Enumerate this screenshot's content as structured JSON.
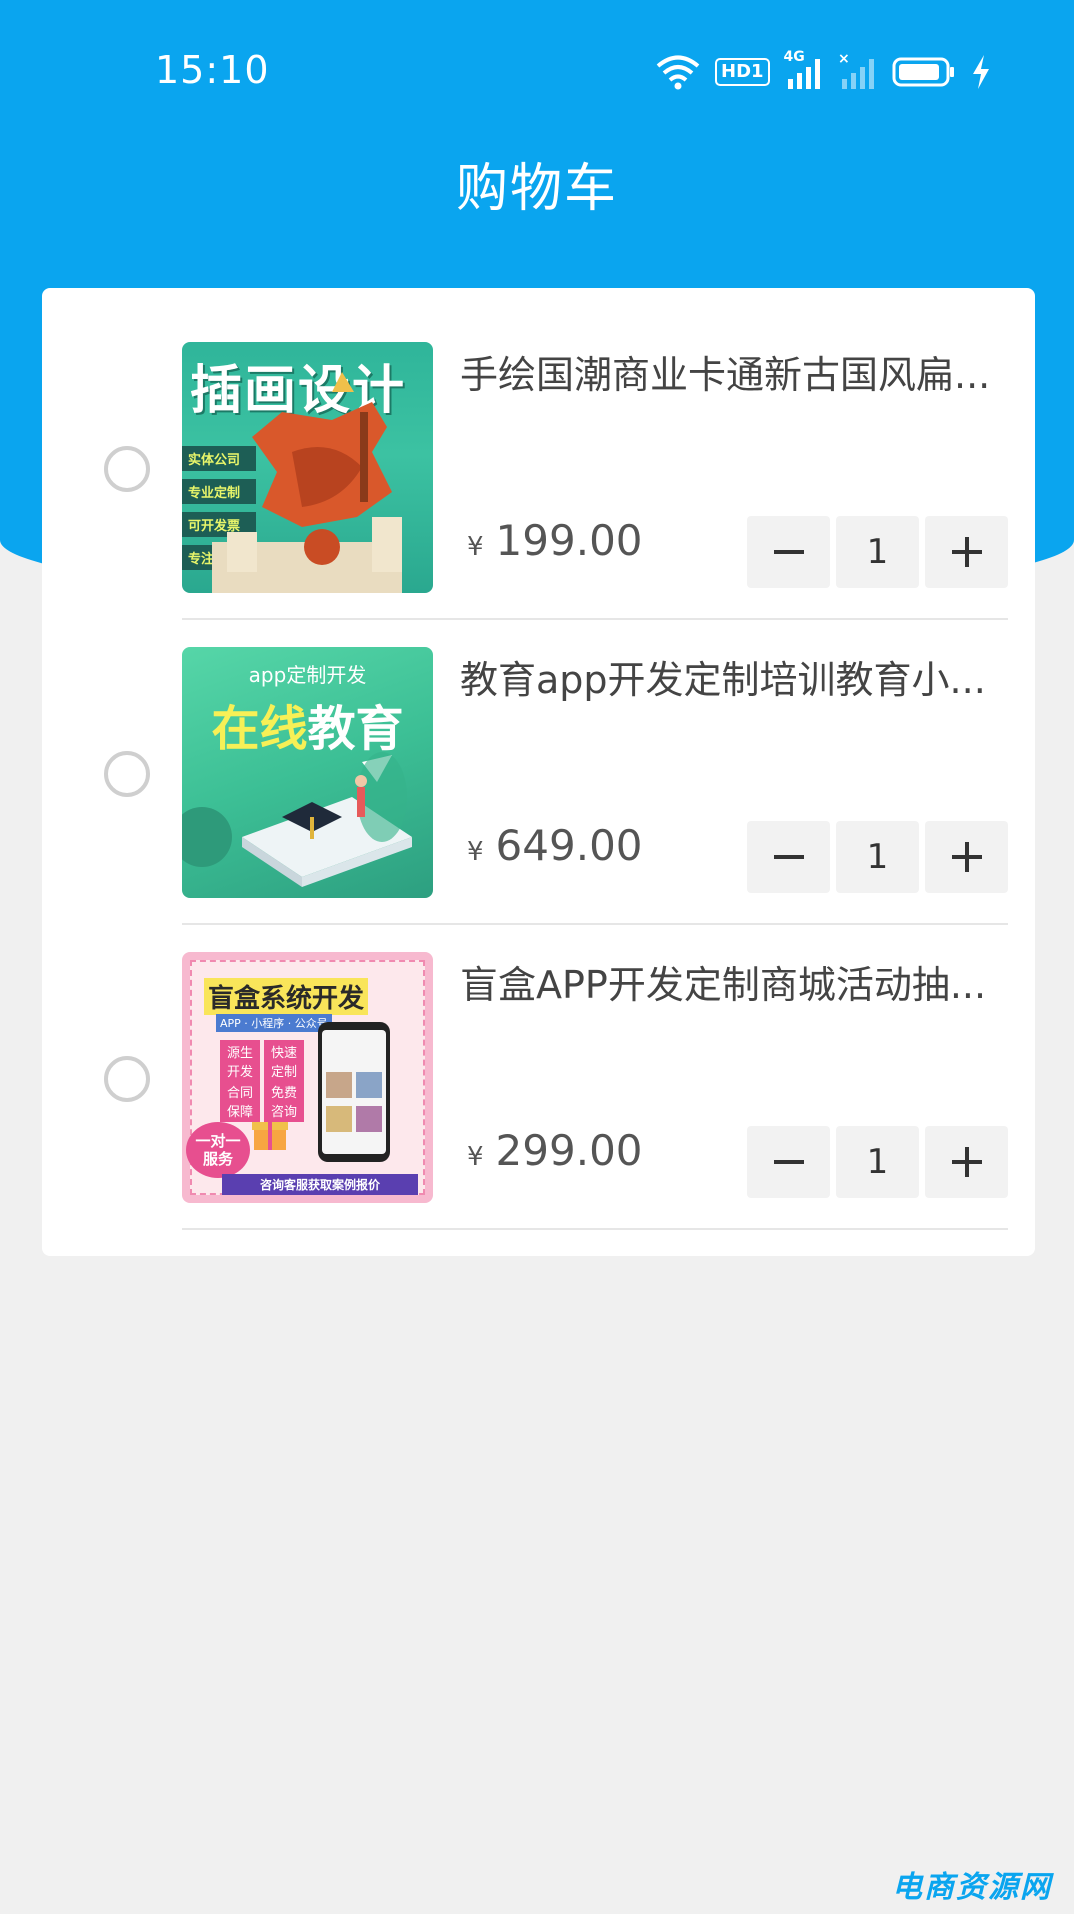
{
  "status_bar": {
    "time": "15:10",
    "network_badge": "HD1",
    "network_type": "4G"
  },
  "header": {
    "title": "购物车"
  },
  "cart": {
    "items": [
      {
        "title": "手绘国潮商业卡通新古国风扁...",
        "currency": "¥",
        "price": "199.00",
        "quantity": "1",
        "thumb_text": {
          "headline": "插画设计",
          "tags": [
            "实体公司",
            "专业定制",
            "可开发票",
            "专注原创"
          ]
        }
      },
      {
        "title": "教育app开发定制培训教育小...",
        "currency": "¥",
        "price": "649.00",
        "quantity": "1",
        "thumb_text": {
          "top": "app定制开发",
          "headline_a": "在线",
          "headline_b": "教育"
        }
      },
      {
        "title": "盲盒APP开发定制商城活动抽...",
        "currency": "¥",
        "price": "299.00",
        "quantity": "1",
        "thumb_text": {
          "headline": "盲盒系统开发",
          "sub": "APP · 小程序 · 公众号",
          "badge_a": "一对一",
          "badge_b": "服务",
          "footer": "咨询客服获取案例报价",
          "features": [
            "源生开发",
            "快速定制",
            "合同保障",
            "免费咨询"
          ]
        }
      }
    ]
  },
  "watermark": "电商资源网",
  "colors": {
    "primary": "#0aa5ef",
    "background": "#f0f0f0"
  }
}
